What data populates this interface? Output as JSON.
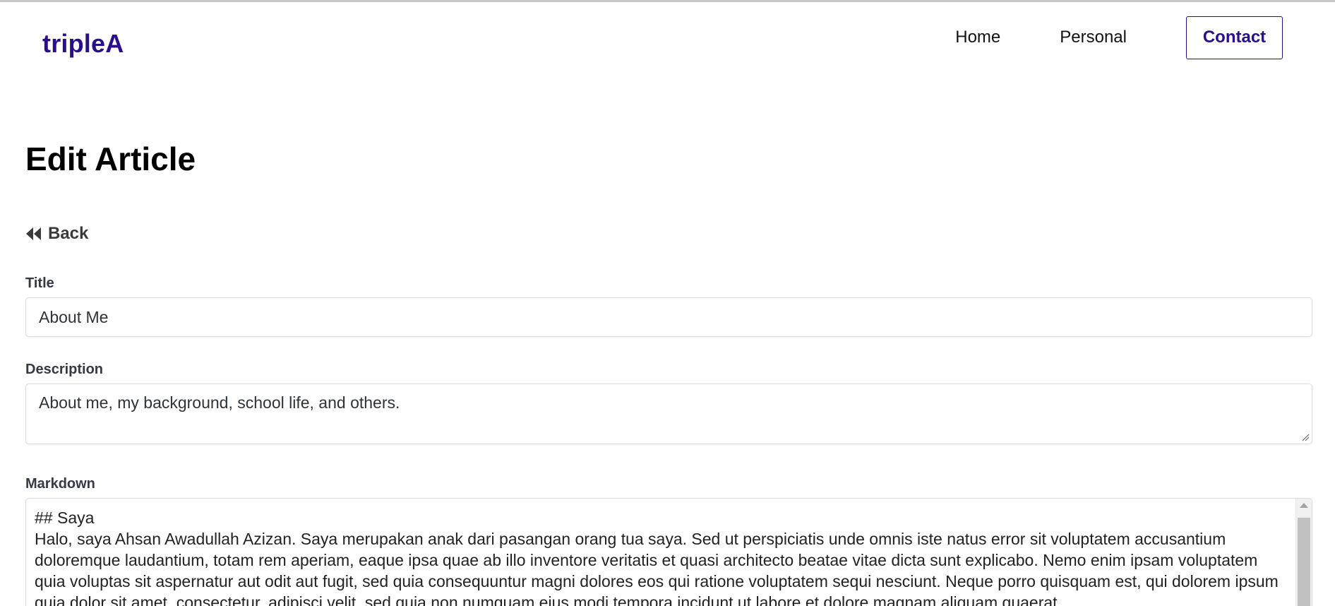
{
  "header": {
    "brand": "tripleA",
    "nav": [
      {
        "label": "Home"
      },
      {
        "label": "Personal"
      }
    ],
    "contact_label": "Contact",
    "accent_color": "#2a0e8c"
  },
  "main": {
    "title": "Edit Article",
    "back_label": "Back",
    "back_icon": "double-chevron-left-icon",
    "fields": {
      "title": {
        "label": "Title",
        "value": "About Me"
      },
      "description": {
        "label": "Description",
        "value": "About me, my background, school life, and others."
      },
      "markdown": {
        "label": "Markdown",
        "lines": [
          "## Saya",
          "Halo, saya Ahsan Awadullah Azizan. Saya merupakan anak dari pasangan orang tua saya. Sed ut perspiciatis unde omnis iste natus error sit voluptatem accusantium doloremque laudantium, totam rem aperiam, eaque ipsa quae ab illo inventore veritatis et quasi architecto beatae vitae dicta sunt explicabo. Nemo enim ipsam voluptatem quia voluptas sit aspernatur aut odit aut fugit, sed quia consequuntur magni dolores eos qui ratione voluptatem sequi nesciunt. Neque porro quisquam est, qui dolorem ipsum quia dolor sit amet, consectetur, adipisci velit, sed quia non numquam eius modi tempora incidunt ut labore et dolore magnam aliquam quaerat"
        ]
      }
    }
  }
}
